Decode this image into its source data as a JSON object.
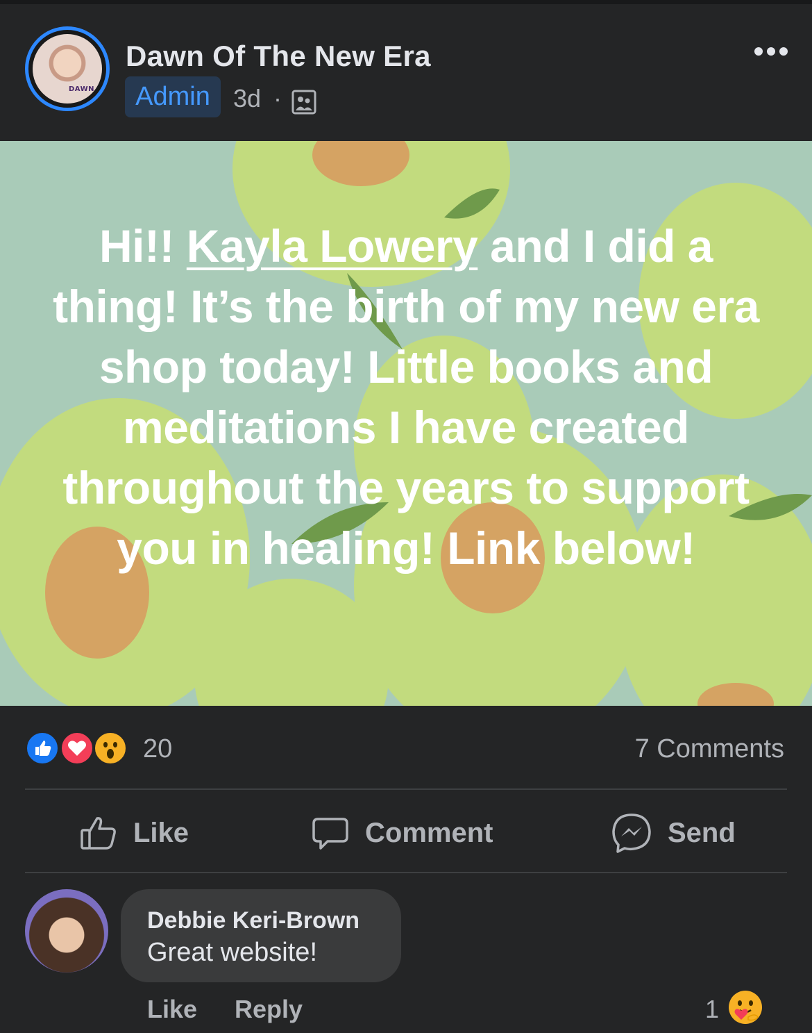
{
  "post": {
    "group_name": "Dawn Of The New Era",
    "avatar_label": "DAWN",
    "role_badge": "Admin",
    "time": "3d",
    "separator": "·",
    "text_parts": {
      "pre": "Hi!! ",
      "mention": "Kayla Lowery",
      "post": " and I did a thing! It’s the birth of my new era shop today! Little books and meditations I have created throughout the years to support you in healing! Link below!"
    },
    "icons": {
      "privacy": "group-members-icon",
      "more": "more-options-icon"
    }
  },
  "stats": {
    "reaction_count": "20",
    "comments": "7 Comments",
    "reactions": [
      "like",
      "love",
      "wow"
    ]
  },
  "actions": {
    "like": "Like",
    "comment": "Comment",
    "send": "Send"
  },
  "comment": {
    "author": "Debbie Keri-Brown",
    "text": "Great website!",
    "like": "Like",
    "reply": "Reply",
    "reaction_count": "1",
    "reaction": "care"
  },
  "colors": {
    "background": "#242526",
    "accent": "#2d88ff",
    "post_background": "#a9cbb8",
    "pear_green": "#c2db7e",
    "pear_core": "#d5a363"
  }
}
